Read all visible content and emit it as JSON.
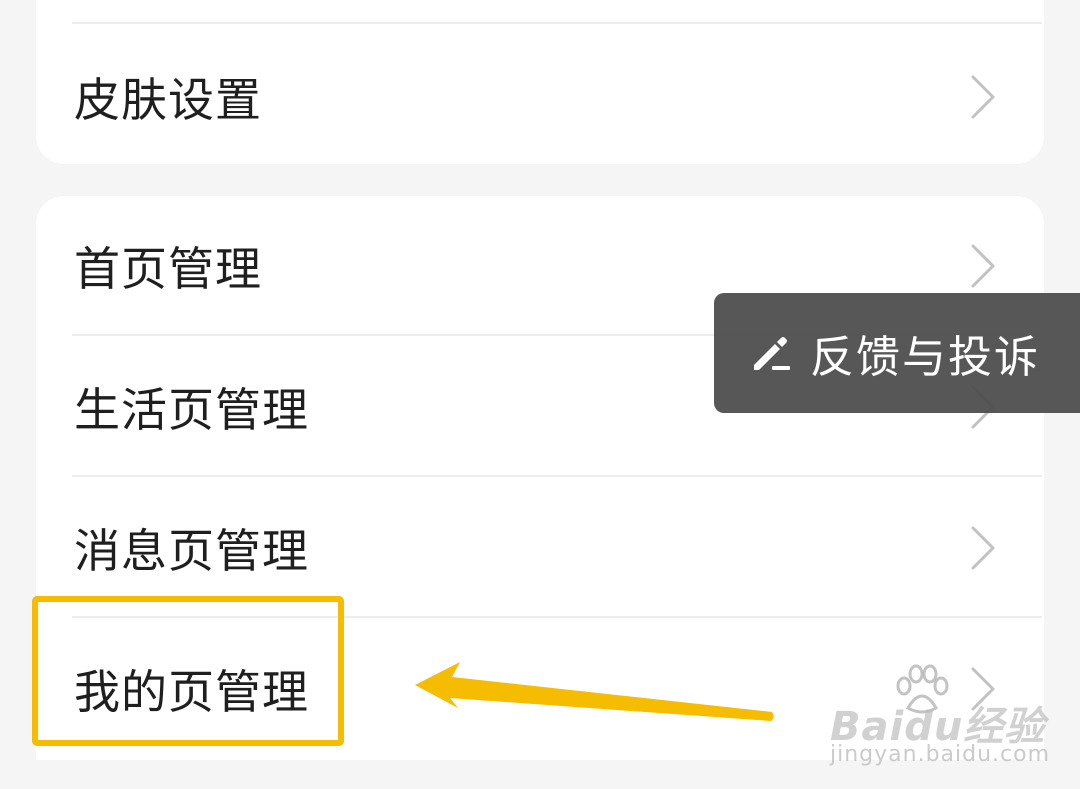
{
  "settings": {
    "top_item": {
      "label": "皮肤设置",
      "icon": "chevron-right-icon"
    },
    "items": [
      {
        "label": "首页管理",
        "icon": "chevron-right-icon"
      },
      {
        "label": "生活页管理",
        "icon": "chevron-right-icon"
      },
      {
        "label": "消息页管理",
        "icon": "chevron-right-icon"
      },
      {
        "label": "我的页管理",
        "icon": "chevron-right-icon"
      }
    ]
  },
  "feedback": {
    "label": "反馈与投诉",
    "icon": "edit-pencil-icon"
  },
  "annotation": {
    "highlight_target": "我的页管理",
    "highlight_color": "#f5bc00",
    "arrow_color": "#f5bc00"
  },
  "watermark": {
    "logo_text": "Baidu经验",
    "url": "jingyan.baidu.com"
  },
  "colors": {
    "background": "#f5f5f5",
    "card": "#ffffff",
    "text": "#1f1f1f",
    "chevron": "#c2c2c2",
    "toast_bg": "#4e4e4e"
  }
}
